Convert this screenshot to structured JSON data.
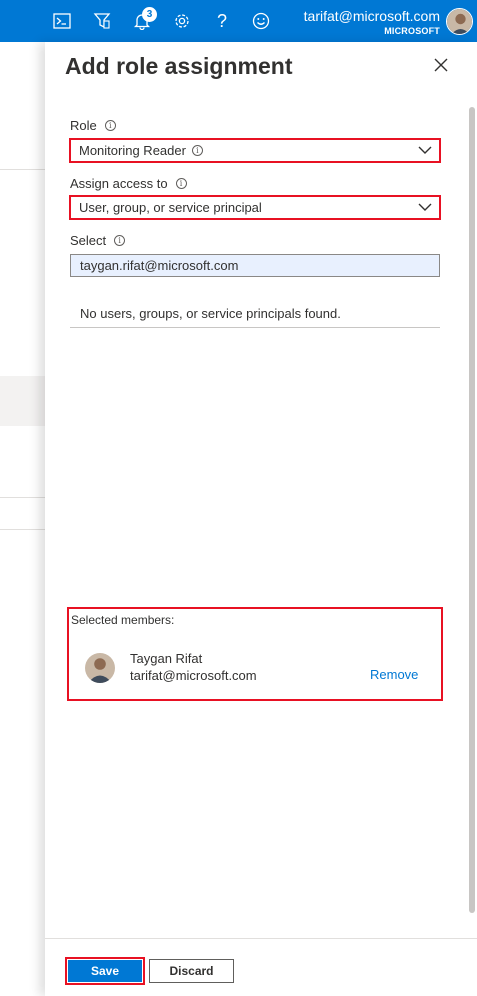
{
  "topbar": {
    "icons": [
      "cloud-shell-icon",
      "directory-filter-icon",
      "notifications-icon",
      "settings-icon",
      "help-icon",
      "feedback-icon"
    ],
    "help_glyph": "?",
    "notification_count": "3",
    "account_email": "tarifat@microsoft.com",
    "account_tenant": "MICROSOFT"
  },
  "blade": {
    "title": "Add role assignment",
    "role": {
      "label": "Role",
      "value": "Monitoring Reader"
    },
    "assign_access": {
      "label": "Assign access to",
      "value": "User, group, or service principal"
    },
    "select": {
      "label": "Select",
      "value": "taygan.rifat@microsoft.com"
    },
    "empty_message": "No users, groups, or service principals found.",
    "selected_members": {
      "label": "Selected members:",
      "members": [
        {
          "name": "Taygan Rifat",
          "email": "tarifat@microsoft.com",
          "action": "Remove"
        }
      ]
    },
    "footer": {
      "save_label": "Save",
      "discard_label": "Discard"
    }
  },
  "colors": {
    "accent": "#0078d4",
    "highlight_border": "#e81123",
    "input_fill": "#e8f0fe"
  }
}
